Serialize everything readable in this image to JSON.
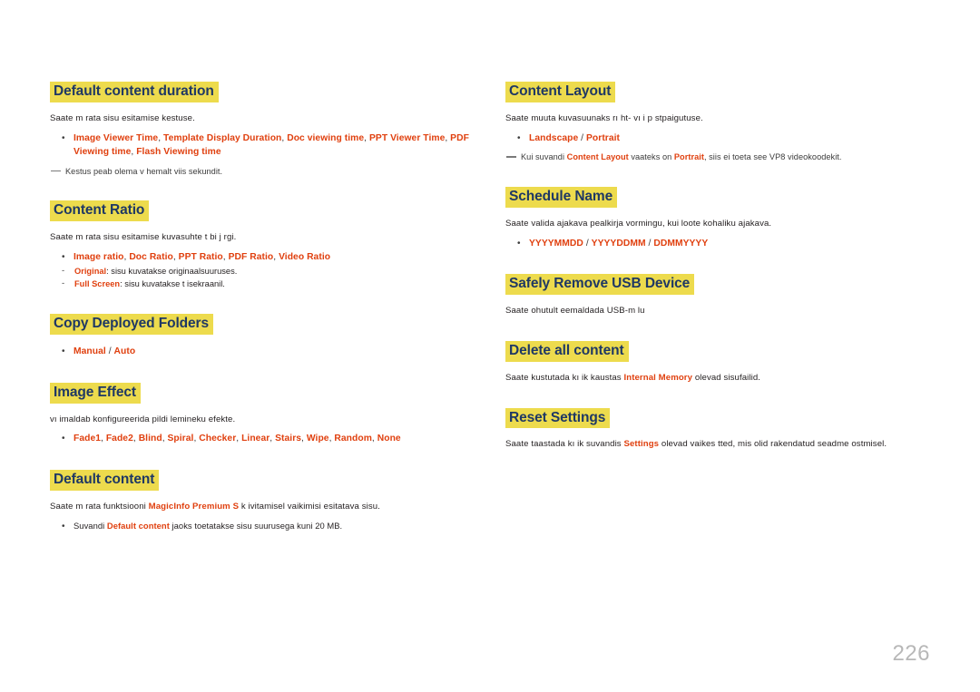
{
  "page": {
    "number": "226"
  },
  "left_column": {
    "sections": [
      {
        "heading": "Default content duration",
        "intro": "Saate m rata sisu esitamise kestuse.",
        "bullet_marker": "•",
        "bullet_terms": [
          "Image Viewer Time",
          "Template Display Duration",
          "Doc viewing time",
          "PPT Viewer Time",
          "PDF Viewing time",
          "Flash Viewing time"
        ],
        "note": "Kestus peab olema v hemalt viis sekundit."
      },
      {
        "heading": "Content Ratio",
        "intro": "Saate m rata sisu esitamise kuvasuhte t  bi j rgi.",
        "bullet_marker": "•",
        "bullet_terms": [
          "Image ratio",
          "Doc Ratio",
          "PPT Ratio",
          "PDF Ratio",
          "Video Ratio"
        ],
        "sub_marker": "-",
        "sub_items": [
          {
            "term": "Original",
            "text": ": sisu kuvatakse originaalsuuruses."
          },
          {
            "term": "Full Screen",
            "text": ": sisu kuvatakse t isekraanil."
          }
        ]
      },
      {
        "heading": "Copy Deployed Folders",
        "bullet_marker": "•",
        "choice_terms": [
          "Manual",
          "Auto"
        ],
        "choice_sep": "/"
      },
      {
        "heading": "Image Effect",
        "intro": "vı imaldab konfigureerida pildi  lemineku efekte.",
        "bullet_marker": "•",
        "bullet_terms": [
          "Fade1",
          "Fade2",
          "Blind",
          "Spiral",
          "Checker",
          "Linear",
          "Stairs",
          "Wipe",
          "Random",
          "None"
        ]
      },
      {
        "heading": "Default content",
        "intro_pre": "Saate m rata funktsiooni ",
        "intro_term": "MagicInfo Premium S",
        "intro_post": " k ivitamisel vaikimisi esitatava sisu.",
        "bullet_marker": "•",
        "bullet_pre": "Suvandi ",
        "bullet_term": "Default content",
        "bullet_post": " jaoks toetatakse sisu suurusega kuni 20 MB."
      }
    ]
  },
  "right_column": {
    "sections": [
      {
        "heading": "Content Layout",
        "intro": "Saate muuta kuvasuunaks rı ht- vı i p stpaigutuse.",
        "bullet_marker": "•",
        "choice_terms": [
          "Landscape",
          "Portrait"
        ],
        "choice_sep": "/",
        "note_pre": "Kui suvandi ",
        "note_term1": "Content Layout",
        "note_mid": " vaateks on ",
        "note_term2": "Portrait",
        "note_post": ", siis ei toeta see VP8 videokoodekit."
      },
      {
        "heading": "Schedule Name",
        "intro": "Saate valida ajakava pealkirja vormingu, kui loote kohaliku ajakava.",
        "bullet_marker": "•",
        "choice_terms": [
          "YYYYMMDD",
          "YYYYDDMM",
          "DDMMYYYY"
        ],
        "choice_sep": "/"
      },
      {
        "heading": "Safely Remove USB Device",
        "intro": "Saate ohutult eemaldada USB-m lu"
      },
      {
        "heading": "Delete all content",
        "intro_pre": "Saate kustutada kı ik kaustas ",
        "intro_term": "Internal Memory",
        "intro_post": " olevad sisufailid."
      },
      {
        "heading": "Reset Settings",
        "intro_pre": "Saate taastada kı ik suvandis ",
        "intro_term": "Settings",
        "intro_post": " olevad vaikes tted, mis olid rakendatud seadme ostmisel."
      }
    ]
  }
}
